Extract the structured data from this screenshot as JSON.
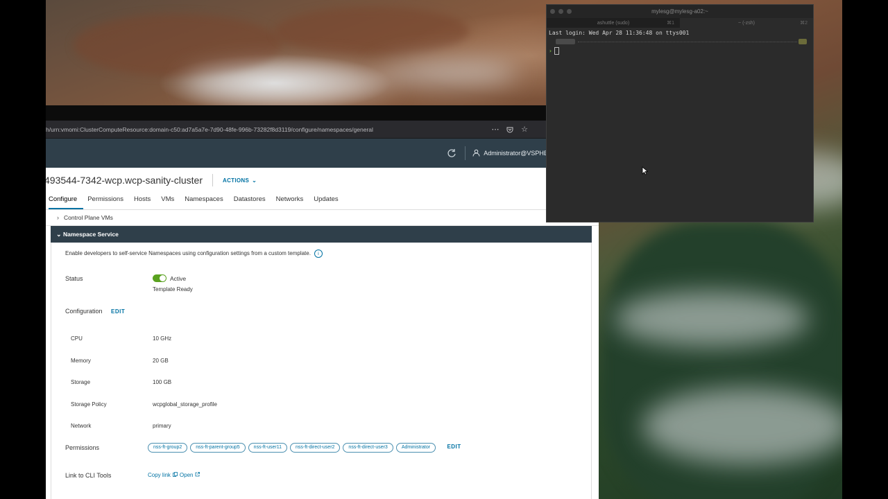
{
  "browser": {
    "url": "h/urn:vmomi:ClusterComputeResource:domain-c50:ad7a5a7e-7d90-48fe-996b-73282f8d3119/configure/namespaces/general"
  },
  "header": {
    "user": "Administrator@VSPHERE.LOCAL"
  },
  "page": {
    "title": "493544-7342-wcp.wcp-sanity-cluster",
    "actions_label": "ACTIONS",
    "tabs": [
      "Configure",
      "Permissions",
      "Hosts",
      "VMs",
      "Namespaces",
      "Datastores",
      "Networks",
      "Updates"
    ],
    "active_tab": "Configure"
  },
  "sections": {
    "control_plane": "Control Plane VMs",
    "namespace_service": "Namespace Service"
  },
  "namespace_service": {
    "description": "Enable developers to self-service Namespaces using configuration settings from a custom template.",
    "status_label": "Status",
    "status_value": "Active",
    "status_sub": "Template Ready",
    "status_toggle_on": true,
    "configuration_label": "Configuration",
    "edit_label": "EDIT",
    "config": [
      {
        "label": "CPU",
        "value": "10 GHz"
      },
      {
        "label": "Memory",
        "value": "20 GB"
      },
      {
        "label": "Storage",
        "value": "100 GB"
      },
      {
        "label": "Storage Policy",
        "value": "wcpglobal_storage_profile"
      },
      {
        "label": "Network",
        "value": "primary"
      }
    ],
    "permissions_label": "Permissions",
    "permissions": [
      "nss-ft-group2",
      "nss-ft-parent-group5",
      "nss-ft-user11",
      "nss-ft-direct-user2",
      "nss-ft-direct-user3",
      "Administrator"
    ],
    "cli_label": "Link to CLI Tools",
    "copy_link": "Copy link",
    "open_link": "Open"
  },
  "terminal": {
    "title": "mylesg@mylesg-a02:~",
    "tabs": [
      {
        "label": "ashuttle (sudo)",
        "shortcut": "⌘1"
      },
      {
        "label": "~ (-zsh)",
        "shortcut": "⌘2"
      }
    ],
    "last_login": "Last login: Wed Apr 28 11:36:48 on ttys001"
  },
  "colors": {
    "accent": "#0072a3",
    "header_bg": "#2f3f4a",
    "toggle_on": "#5aa220",
    "terminal_bg": "#2b2b2b"
  }
}
